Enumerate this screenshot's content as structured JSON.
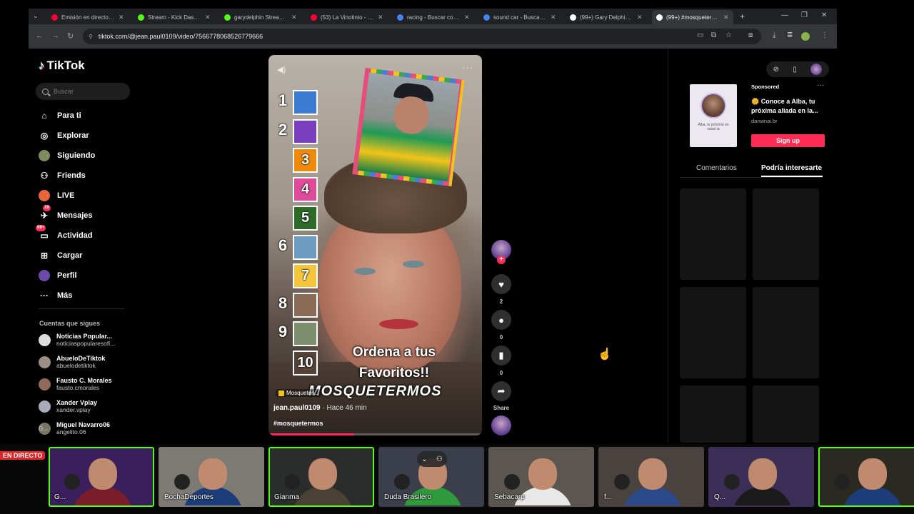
{
  "browser": {
    "tabs": [
      {
        "title": "Emisión en directo - Yo",
        "color": "#ff0033",
        "active": false
      },
      {
        "title": "Stream - Kick Dashboard",
        "color": "#53fc18",
        "active": false
      },
      {
        "title": "garydelphin Stream - W",
        "color": "#53fc18",
        "active": false
      },
      {
        "title": "(53) La Vinotinto - Cana",
        "color": "#ff0033",
        "active": false
      },
      {
        "title": "racing - Buscar con Goo",
        "color": "#4285f4",
        "active": false
      },
      {
        "title": "sound car - Buscar con",
        "color": "#4285f4",
        "active": false
      },
      {
        "title": "(99+) Gary Delphin ve",
        "color": "#ffffff",
        "active": false
      },
      {
        "title": "(99+) #mosquetermo",
        "color": "#ffffff",
        "active": true
      }
    ],
    "url": "tiktok.com/@jean.paul0109/video/7566778068526779666"
  },
  "sidebar": {
    "logo": "TikTok",
    "search_placeholder": "Buscar",
    "nav": [
      {
        "label": "Para ti",
        "icon": "home-icon",
        "glyph": "⌂",
        "badge": ""
      },
      {
        "label": "Explorar",
        "icon": "compass-icon",
        "glyph": "◎",
        "badge": ""
      },
      {
        "label": "Siguiendo",
        "icon": "following-avatar-icon",
        "glyph": "●",
        "badge": ""
      },
      {
        "label": "Friends",
        "icon": "friends-icon",
        "glyph": "⚇",
        "badge": ""
      },
      {
        "label": "LIVE",
        "icon": "live-avatar-icon",
        "glyph": "●",
        "badge": ""
      },
      {
        "label": "Mensajes",
        "icon": "messages-icon",
        "glyph": "✈",
        "badge": "19"
      },
      {
        "label": "Actividad",
        "icon": "activity-icon",
        "glyph": "▭",
        "badge": "99+"
      },
      {
        "label": "Cargar",
        "icon": "upload-icon",
        "glyph": "⊞",
        "badge": ""
      },
      {
        "label": "Perfil",
        "icon": "profile-avatar-icon",
        "glyph": "●",
        "badge": ""
      },
      {
        "label": "Más",
        "icon": "more-icon",
        "glyph": "···",
        "badge": ""
      }
    ],
    "following_title": "Cuentas que sigues",
    "following": [
      {
        "name": "Noticias Popular...",
        "handle": "noticiaspopularesofi...",
        "color": "#ddd"
      },
      {
        "name": "AbueloDeTiktok",
        "handle": "abuelodetiktok",
        "color": "#9c8f86"
      },
      {
        "name": "Fausto C. Morales",
        "handle": "fausto.cmorales",
        "color": "#8f6a5a"
      },
      {
        "name": "Xander Vplay",
        "handle": "xander.vplay",
        "color": "#aab"
      },
      {
        "name": "Miguel Navarro06",
        "handle": "angelito.06",
        "color": "#776"
      }
    ]
  },
  "video": {
    "ranking": [
      {
        "num": "1",
        "box": "",
        "box_color": "#3b7bd1"
      },
      {
        "num": "2",
        "box": "",
        "box_color": "#7a3fbf"
      },
      {
        "num": "",
        "box": "3",
        "box_color": "#f08a0b"
      },
      {
        "num": "",
        "box": "4",
        "box_color": "#e14a99"
      },
      {
        "num": "",
        "box": "5",
        "box_color": "#2e6b28"
      },
      {
        "num": "6",
        "box": "",
        "box_color": "#6e9bc2"
      },
      {
        "num": "",
        "box": "7",
        "box_color": "#f4c63b"
      },
      {
        "num": "8",
        "box": "",
        "box_color": "#8a6b56"
      },
      {
        "num": "9",
        "box": "",
        "box_color": "#7e8f6d"
      },
      {
        "num": "",
        "box": "10",
        "box_color": "#55433a"
      }
    ],
    "overlay_title": "Ordena a tus Favoritos!!",
    "watermark": "MOSQUETERMOS",
    "tag_chip": "Mosqueter...",
    "author": "jean.paul0109",
    "time": "Hace 46 min",
    "hashtags": "#mosquetermos",
    "progress": 0.4
  },
  "actions": {
    "likes": "2",
    "comments": "0",
    "saves": "0",
    "share_label": "Share"
  },
  "ad": {
    "sponsored": "Sponsored",
    "thumb_caption": "Alba, tu próxima en salud ia",
    "title": "🌼 Conoce a Alba, tu próxima aliada en la...",
    "url": "darwinai.br",
    "cta": "Sign up"
  },
  "right_tabs": {
    "comments": "Comentarios",
    "related": "Podría interesarte"
  },
  "streamers": [
    {
      "label": "G...",
      "bg": "#3a1f5c",
      "shirt": "#7a1d2a",
      "selected": true
    },
    {
      "label": "BochaDeportes",
      "bg": "#7d7a74",
      "shirt": "#1c3d7a",
      "selected": false
    },
    {
      "label": "Gianma",
      "bg": "#2b2d2c",
      "shirt": "#4a4033",
      "selected": true
    },
    {
      "label": "Duda Brasilero",
      "bg": "#3b3f4c",
      "shirt": "#2f9a3c",
      "selected": false
    },
    {
      "label": "Sebacarp",
      "bg": "#5c5650",
      "shirt": "#e8e8e8",
      "selected": false
    },
    {
      "label": "f...",
      "bg": "#4a423e",
      "shirt": "#2c4a8a",
      "selected": false
    },
    {
      "label": "Q...",
      "bg": "#3b2e57",
      "shirt": "#1a1a1a",
      "selected": false
    },
    {
      "label": "",
      "bg": "#2a2a22",
      "shirt": "#1d3d7a",
      "selected": true
    }
  ],
  "side_cam_label": "G..."
}
